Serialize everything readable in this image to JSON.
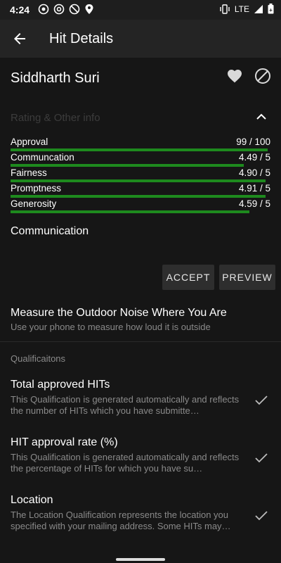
{
  "status_bar": {
    "time": "4:24",
    "network": "LTE",
    "left_icons": [
      "whatsapp-icon",
      "at-icon",
      "circle-slash-icon",
      "location-icon"
    ],
    "right_icons": [
      "vibrate-icon",
      "signal-icon",
      "battery-icon"
    ]
  },
  "app_bar": {
    "title": "Hit Details"
  },
  "requester": {
    "name": "Siddharth Suri"
  },
  "ratings": {
    "header": "Rating & Other info",
    "items": [
      {
        "label": "Approval",
        "value": "99 / 100",
        "fraction": 0.99
      },
      {
        "label": "Communcation",
        "value": "4.49 / 5",
        "fraction": 0.898
      },
      {
        "label": "Fairness",
        "value": "4.90 / 5",
        "fraction": 0.98
      },
      {
        "label": "Promptness",
        "value": "4.91 / 5",
        "fraction": 0.982
      },
      {
        "label": "Generosity",
        "value": "4.59 / 5",
        "fraction": 0.918
      }
    ]
  },
  "communication": {
    "title": "Communication"
  },
  "actions": {
    "accept": "ACCEPT",
    "preview": "PREVIEW"
  },
  "hit": {
    "title": "Measure the Outdoor Noise Where You Are",
    "description": "Use your phone to measure how loud it is outside"
  },
  "qualifications": {
    "header": "Qualificaitons",
    "items": [
      {
        "title": "Total approved HITs",
        "description": "This Qualification is generated automatically and reflects the number of HITs which you have submitte…"
      },
      {
        "title": "HIT approval rate (%)",
        "description": "This Qualification is generated automatically and reflects the percentage of HITs for which you have su…"
      },
      {
        "title": "Location",
        "description": "The Location Qualification represents the location you specified with your mailing address.  Some HITs may…"
      }
    ]
  },
  "colors": {
    "bar_green": "#1e8a1e",
    "background": "#161616",
    "app_bar": "#242424"
  }
}
